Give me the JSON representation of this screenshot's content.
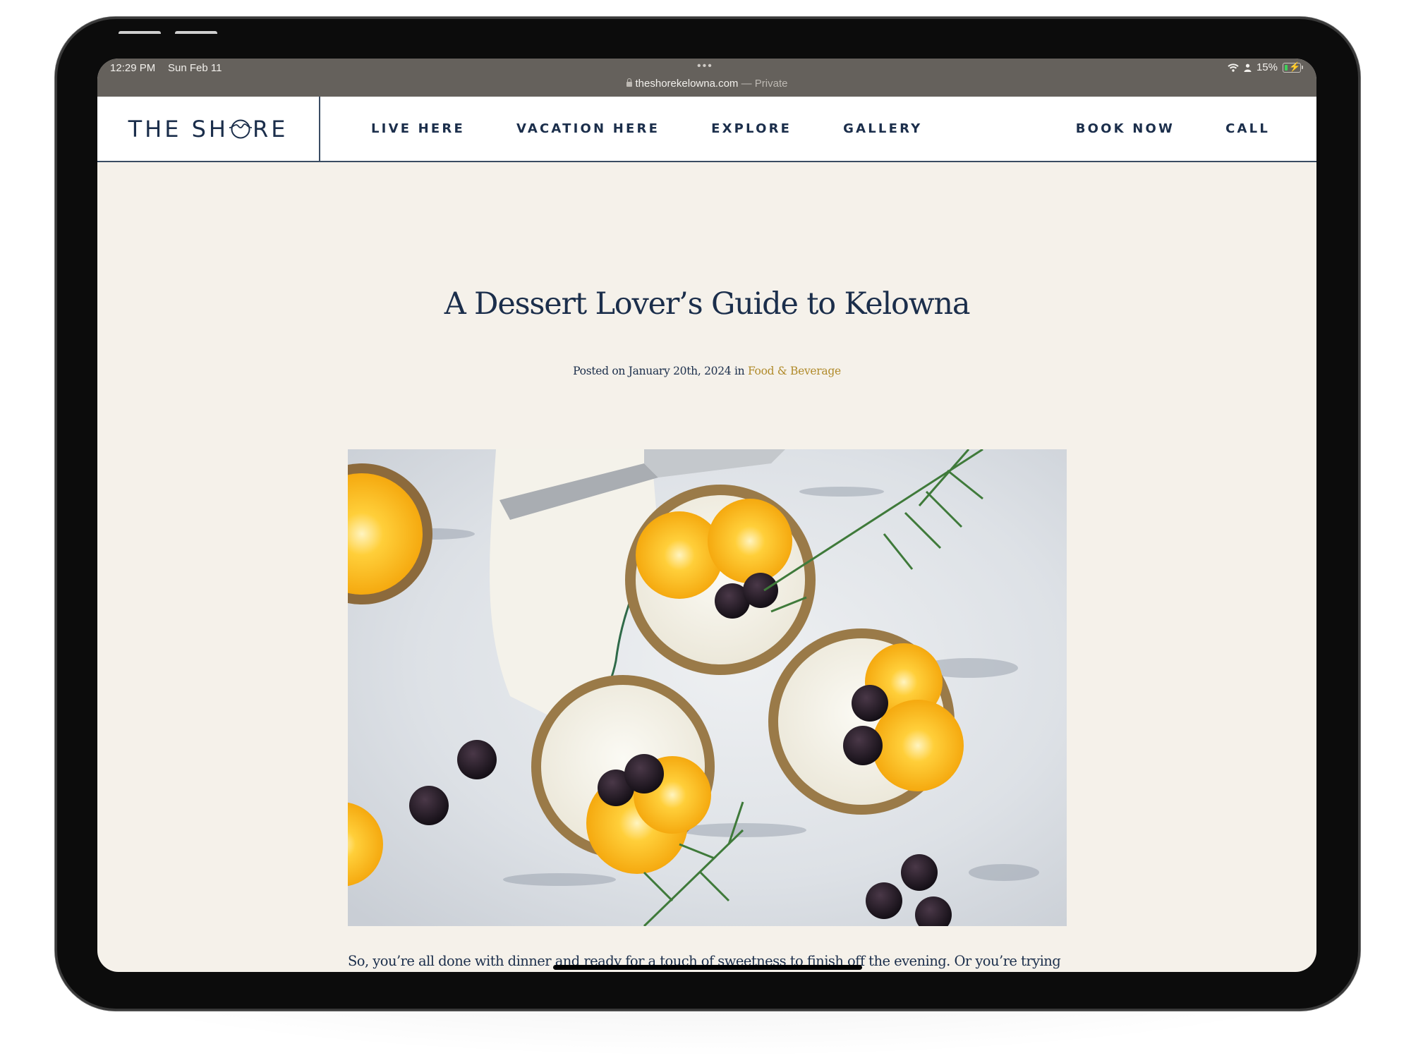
{
  "statusbar": {
    "time": "12:29 PM",
    "date": "Sun Feb 11",
    "more_dots": "•••",
    "url": "theshorekelowna.com",
    "private_label": "— Private",
    "battery_percent": "15%",
    "battery_level": 0.15,
    "icons": [
      "wifi-icon",
      "person-icon",
      "battery-charging-icon",
      "lock-icon"
    ]
  },
  "header": {
    "logo_left": "THE SH",
    "logo_right": "RE",
    "logo_alt": "THE SHORE",
    "nav_left": [
      {
        "label": "LIVE HERE"
      },
      {
        "label": "VACATION HERE"
      },
      {
        "label": "EXPLORE"
      },
      {
        "label": "GALLERY"
      }
    ],
    "nav_right": [
      {
        "label": "BOOK NOW"
      },
      {
        "label": "CALL"
      }
    ]
  },
  "article": {
    "title": "A Dessert Lover’s Guide to Kelowna",
    "meta_prefix": "Posted on January 20th, 2024 in",
    "category": "Food & Beverage",
    "image_alt": "Orange and blackberry cream tarts with rosemary on a marble surface",
    "paragraph": "So, you’re all done with dinner and ready for a touch of sweetness to finish off the evening. Or you’re trying to figure out the best thing to bring to a friend’s potluck and have run out of time to make or bake anything. Fear not – from artisanal bakeries to charming cafes, Kelowna offers a wide range of sweet treats that will satisfy that dessert craving for all. Join us as we explore Kelowna’s best desserts and treat-eries."
  },
  "colors": {
    "navy": "#1b2e4b",
    "gold": "#b08a2a",
    "page_bg": "#f5f1ea",
    "statusbar_bg": "#65615c"
  }
}
